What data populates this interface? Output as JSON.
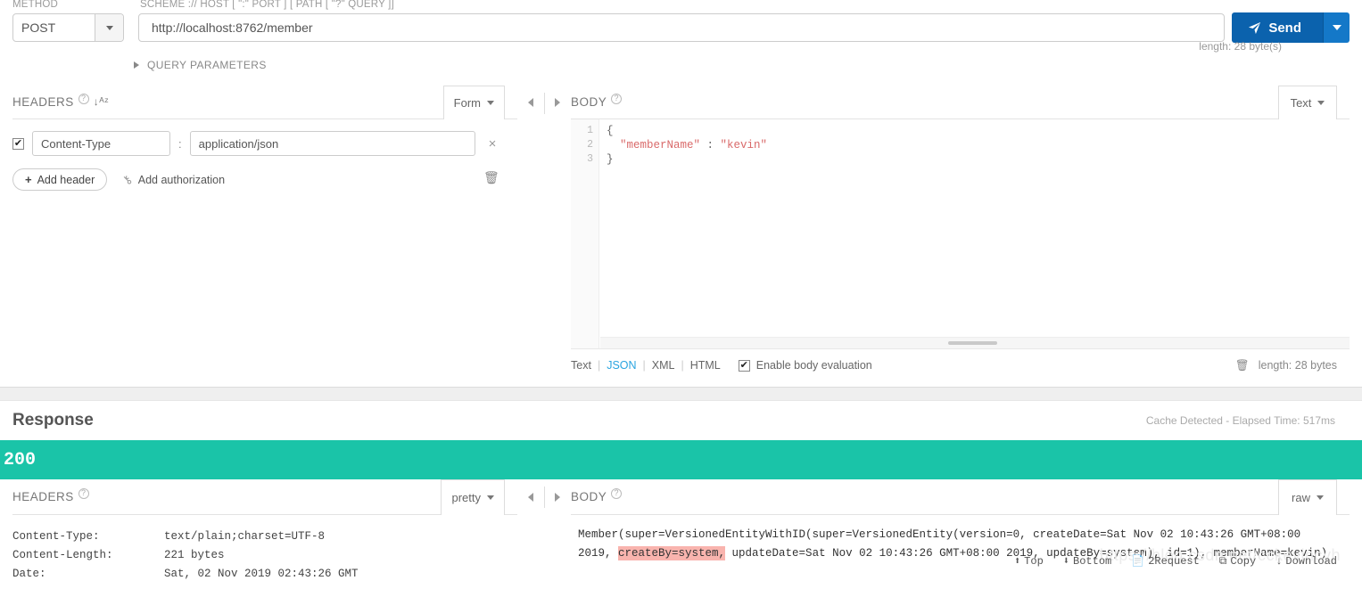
{
  "request": {
    "captions": {
      "method": "METHOD",
      "url": "SCHEME :// HOST [ \":\" PORT ] [ PATH [ \"?\" QUERY ]]"
    },
    "method": "POST",
    "url": "http://localhost:8762/member",
    "send_label": "Send",
    "length_note": "length: 28 byte(s)",
    "query_parameters_label": "QUERY PARAMETERS"
  },
  "headers_panel": {
    "title": "HEADERS",
    "help_icon": "?",
    "sort_icon": "↓ᴬᶻ",
    "format_dropdown": "Form",
    "rows": [
      {
        "enabled": true,
        "key": "Content-Type",
        "value": "application/json",
        "remove": "×"
      }
    ],
    "add_header_label": "Add header",
    "add_header_plus": "+",
    "add_authorization_label": "Add authorization",
    "key_icon": "⚷",
    "trash_icon": "🗑"
  },
  "body_panel": {
    "title": "BODY",
    "help_icon": "?",
    "format_dropdown": "Text",
    "line_numbers": [
      "1",
      "2",
      "3"
    ],
    "code_lines": [
      {
        "plain": "{",
        "string": ""
      },
      {
        "prefix": "  ",
        "key": "\"memberName\"",
        "mid": " : ",
        "val": "\"kevin\""
      },
      {
        "plain": "}",
        "string": ""
      }
    ],
    "formats": [
      "Text",
      "JSON",
      "XML",
      "HTML"
    ],
    "active_format": "JSON",
    "separator": "|",
    "enable_body_evaluation": "Enable body evaluation",
    "enable_body_evaluation_checked": true,
    "trash_icon": "🗑",
    "length_label": "length: 28 bytes"
  },
  "response": {
    "title": "Response",
    "meta": "Cache Detected - Elapsed Time: 517ms",
    "status_code": "200",
    "status_color": "#1ac4a8",
    "headers_panel": {
      "title": "HEADERS",
      "help_icon": "?",
      "format_dropdown": "pretty",
      "rows": [
        {
          "key": "Content-Type:",
          "value": "text/plain;charset=UTF-8"
        },
        {
          "key": "Content-Length:",
          "value": "221 bytes"
        },
        {
          "key": "Date:",
          "value": "Sat, 02 Nov 2019 02:43:26 GMT"
        }
      ]
    },
    "body_panel": {
      "title": "BODY",
      "help_icon": "?",
      "format_dropdown": "raw",
      "text_before": "Member(super=VersionedEntityWithID(super=VersionedEntity(version=0, createDate=Sat Nov 02 10:43:26 GMT+08:00 2019, ",
      "highlight": "createBy=system,",
      "text_after": " updateDate=Sat Nov 02 10:43:26 GMT+08:00 2019, updateBy=system), id=1), memberName=kevin)",
      "highlight_color": "#f9b4ae",
      "tools": [
        {
          "icon": "⬆",
          "label": "Top"
        },
        {
          "icon": "⬇",
          "label": "Bottom"
        },
        {
          "icon": "📄",
          "label": "2Request"
        },
        {
          "icon": "⧉",
          "label": "Copy"
        },
        {
          "icon": "↓",
          "label": "Download"
        }
      ]
    },
    "watermark": "https://blog.csdn.net/cckevincyh"
  },
  "colors": {
    "send_blue": "#0b62ad",
    "send_caret_blue": "#1478c8",
    "status_teal": "#1ac4a8",
    "active_format_blue": "#29a4e0",
    "string_red": "#d96a6a"
  }
}
